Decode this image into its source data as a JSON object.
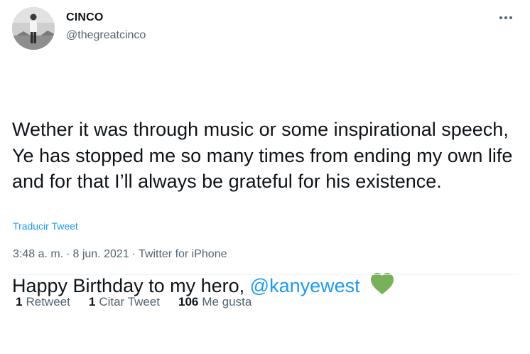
{
  "user": {
    "display_name": "CINCO",
    "handle": "@thegreatcinco"
  },
  "tweet": {
    "paragraph1": "Wether it was through music or some inspirational speech, Ye has stopped me so many times from ending my own life and for that I’ll always be grateful for his existence.",
    "paragraph2_text": "Happy Birthday to my hero, ",
    "mention": "@kanyewest",
    "emoji_icon": "green-heart-icon"
  },
  "translate_label": "Traducir Tweet",
  "meta": {
    "time": "3:48 a. m.",
    "date": "8 jun. 2021",
    "source": "Twitter for iPhone",
    "separator": "·"
  },
  "stats": {
    "retweets_count": "1",
    "retweets_label": "Retweet",
    "quotes_count": "1",
    "quotes_label": "Citar Tweet",
    "likes_count": "106",
    "likes_label": "Me gusta"
  },
  "colors": {
    "accent": "#1d9bf0",
    "heart": "#78b159",
    "secondary_text": "#536471"
  }
}
